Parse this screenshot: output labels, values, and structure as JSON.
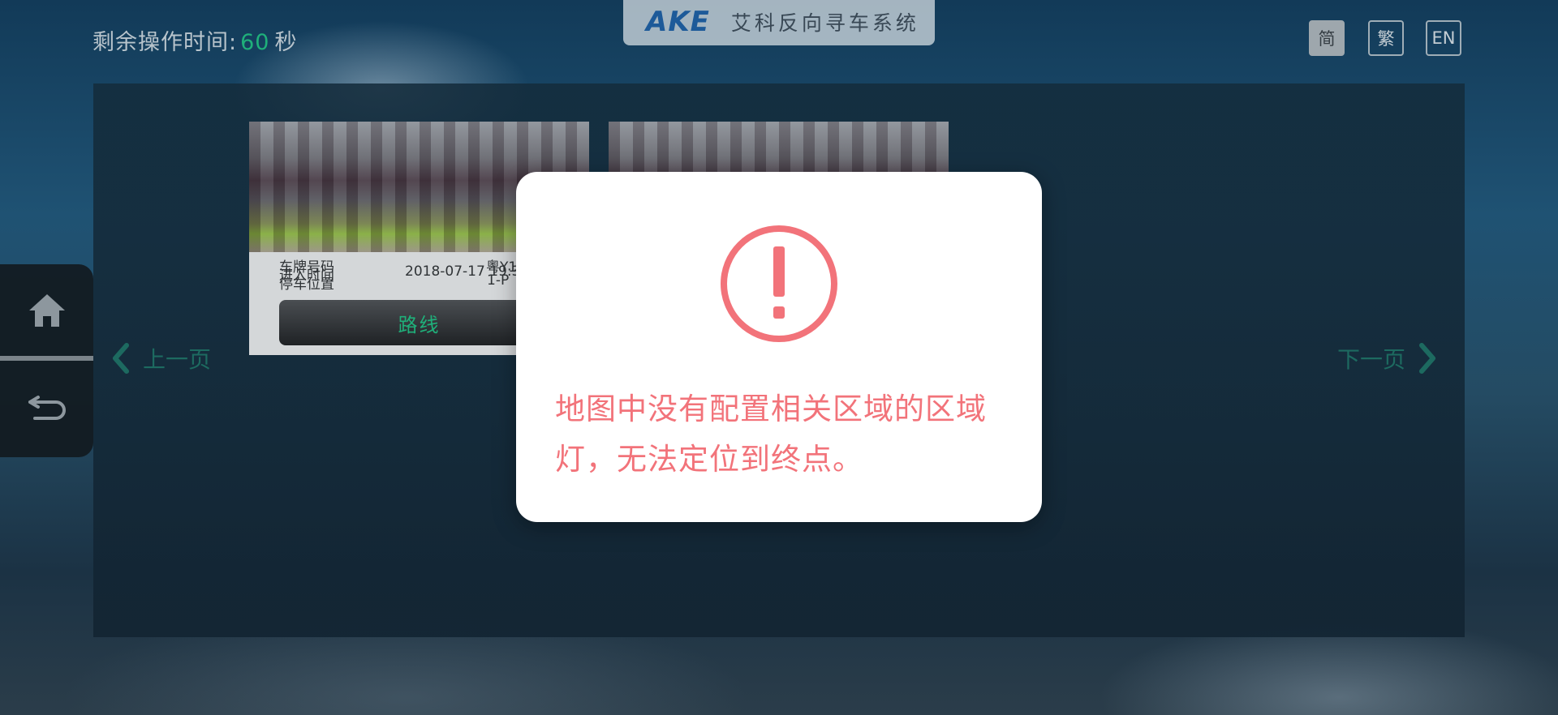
{
  "header": {
    "timer_label": "剩余操作时间:",
    "timer_value": "60",
    "timer_unit": "秒",
    "brand_logo": "AKE",
    "brand_title": "艾科反向寻车系统"
  },
  "languages": [
    {
      "label": "简",
      "active": true
    },
    {
      "label": "繁",
      "active": false
    },
    {
      "label": "EN",
      "active": false
    }
  ],
  "cards": [
    {
      "plate_label": "车牌号码",
      "plate_value": "粤Y1",
      "time_label": "进入时间",
      "time_value": "2018-07-17 19:3",
      "location_label": "停车位置",
      "location_value": "1-P",
      "route_label": "路线"
    },
    {
      "plate_label": "",
      "plate_value": "",
      "time_label": "",
      "time_value": "",
      "location_label": "",
      "location_value": "",
      "route_label": ""
    }
  ],
  "pager": {
    "prev_label": "上一页",
    "next_label": "下一页"
  },
  "sidebar": {
    "home_icon": "home-icon",
    "back_icon": "back-icon"
  },
  "modal": {
    "icon": "exclamation-circle-icon",
    "message": "地图中没有配置相关区域的区域灯，无法定位到终点。",
    "accent_color": "#f2737a"
  }
}
